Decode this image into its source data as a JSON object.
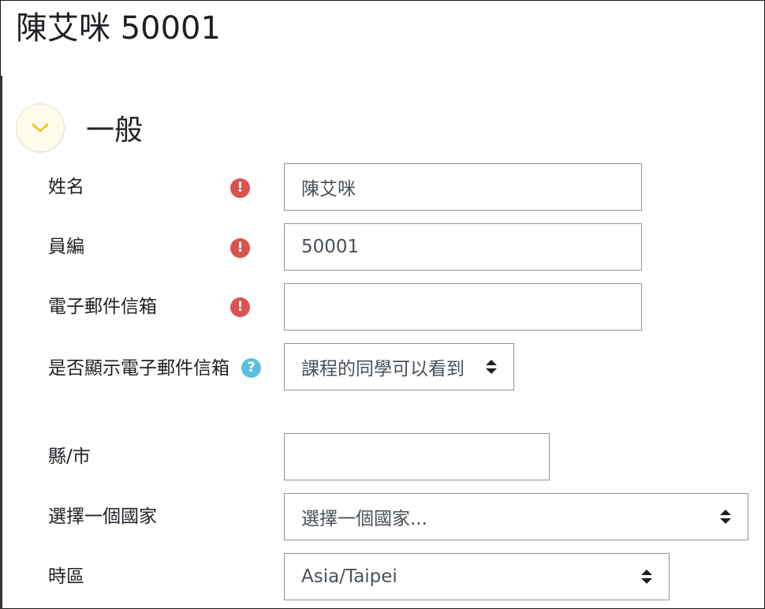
{
  "page": {
    "title": "陳艾咪 50001"
  },
  "section": {
    "title": "一般",
    "collapse_icon": "chevron-down-icon",
    "icon_color": "#f0c419"
  },
  "fields": {
    "name": {
      "label": "姓名",
      "value": "陳艾咪",
      "required_icon": "!"
    },
    "employee_id": {
      "label": "員編",
      "value": "50001",
      "required_icon": "!"
    },
    "email": {
      "label": "電子郵件信箱",
      "value": "",
      "required_icon": "!"
    },
    "email_display": {
      "label": "是否顯示電子郵件信箱",
      "selected": "課程的同學可以看到",
      "help_icon": "?"
    },
    "city": {
      "label": "縣/市",
      "value": ""
    },
    "country": {
      "label": "選擇一個國家",
      "selected": "選擇一個國家..."
    },
    "timezone": {
      "label": "時區",
      "selected": "Asia/Taipei"
    }
  },
  "colors": {
    "required": "#d9534f",
    "help": "#5bc0de",
    "border": "#8f959e"
  }
}
